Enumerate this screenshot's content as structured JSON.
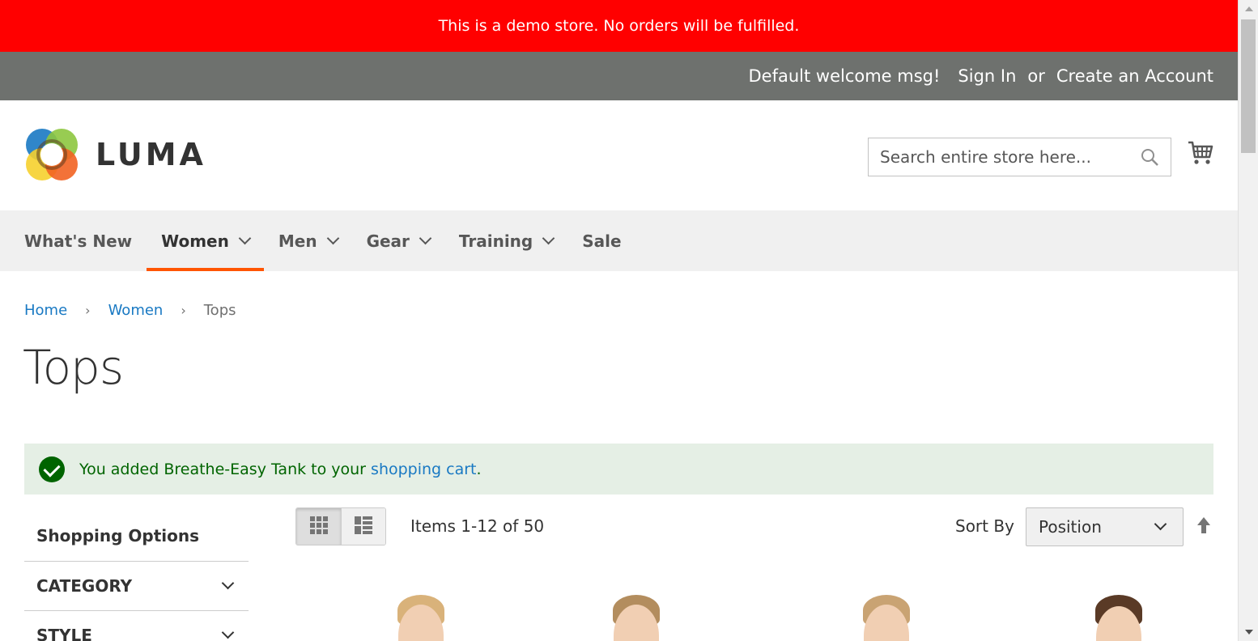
{
  "demo_notice": "This is a demo store. No orders will be fulfilled.",
  "header_links": {
    "welcome": "Default welcome msg!",
    "sign_in": "Sign In",
    "or": "or",
    "create_account": "Create an Account"
  },
  "logo": {
    "text": "LUMA",
    "colors": [
      "#1979c3",
      "#8dc63f",
      "#f6d02e",
      "#f26322"
    ]
  },
  "search": {
    "placeholder": "Search entire store here...",
    "value": ""
  },
  "nav": {
    "items": [
      {
        "label": "What's New",
        "has_dropdown": false
      },
      {
        "label": "Women",
        "has_dropdown": true,
        "active": true
      },
      {
        "label": "Men",
        "has_dropdown": true
      },
      {
        "label": "Gear",
        "has_dropdown": true
      },
      {
        "label": "Training",
        "has_dropdown": true
      },
      {
        "label": "Sale",
        "has_dropdown": false
      }
    ],
    "active_color": "#ff5501"
  },
  "breadcrumb": {
    "home": "Home",
    "women": "Women",
    "current": "Tops"
  },
  "page_title": "Tops",
  "message": {
    "prefix": "You added Breathe-Easy Tank to your ",
    "link": "shopping cart",
    "suffix": "."
  },
  "sidebar": {
    "title": "Shopping Options",
    "filters": [
      "Category",
      "Style"
    ]
  },
  "toolbar": {
    "amount": "Items 1-12 of 50",
    "sort_label": "Sort By",
    "sort_value": "Position",
    "view_modes": [
      "grid",
      "list"
    ],
    "active_view_mode": "grid"
  }
}
